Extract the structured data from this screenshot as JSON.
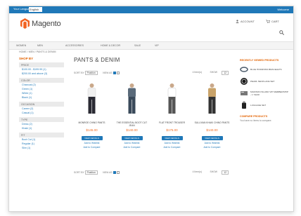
{
  "topbar": {
    "language_label": "Your Language:",
    "language_value": "English",
    "right_link": "Welcome"
  },
  "header": {
    "logo_text": "Magento",
    "account_label": "ACCOUNT",
    "cart_label": "CART"
  },
  "nav": {
    "items": [
      "WOMEN",
      "MEN",
      "ACCESSORIES",
      "HOME & DECOR",
      "SALE",
      "VIP"
    ]
  },
  "breadcrumb": "HOME / MEN / PANTS & DENIM",
  "sidebar": {
    "shop_by": "SHOP BY",
    "filters": [
      {
        "title": "PRICE",
        "options": [
          "$100.00 - $199.99 (1)",
          "$200.00 and above (3)"
        ]
      },
      {
        "title": "COLOR",
        "options": [
          "Charcoal (2)",
          "Green (1)",
          "White (1)",
          "Black (1)"
        ]
      },
      {
        "title": "OCCASION",
        "options": [
          "Career (2)",
          "Casual (1)"
        ]
      },
      {
        "title": "TYPE",
        "options": [
          "Dress (2)",
          "Khaki (1)"
        ]
      },
      {
        "title": "FIT",
        "options": [
          "Boot Cut (1)",
          "Regular (1)",
          "Slim (1)"
        ]
      }
    ]
  },
  "main": {
    "page_title": "PANTS & DENIM",
    "sort_label": "SORT BY",
    "sort_value": "Position",
    "view_label": "VIEW AS",
    "items_text": "4 Item(s)",
    "show_label": "SHOW",
    "show_value": "12"
  },
  "products": [
    {
      "name": "MONROE CHINO PANTS",
      "price": "$145.00",
      "button": "VIEW DETAILS",
      "wishlist": "Add to Wishlist",
      "compare": "Add to Compare",
      "color": "#2a2a33"
    },
    {
      "name": "THE ESSENTIAL BOOT CUT JEAN",
      "price": "$140.00",
      "button": "VIEW DETAILS",
      "wishlist": "Add to Wishlist",
      "compare": "Add to Compare",
      "color": "#3a4a5a"
    },
    {
      "name": "FLAT FRONT TROUSER",
      "price": "$175.00",
      "button": "VIEW DETAILS",
      "wishlist": "Add to Wishlist",
      "compare": "Add to Compare",
      "color": "#555555"
    },
    {
      "name": "SULLIVAN KHAKI CHINO PANTS",
      "price": "$140.00",
      "button": "VIEW DETAILS",
      "wishlist": "Add to Wishlist",
      "compare": "Add to Compare",
      "color": "#333333"
    }
  ],
  "right_sidebar": {
    "recent_title": "RECENTLY VIEWED PRODUCTS",
    "recent_items": [
      "BLUE HORIZONS BRACELETS",
      "PEARL NECKLACE SET",
      "MADISON ISLAND VIP MEMBERSHIP - 1 YEAR",
      "LUGGAGE SET"
    ],
    "compare_title": "COMPARE PRODUCTS",
    "compare_text": "You have no items to compare."
  },
  "colors": {
    "brand_blue": "#1f78b8",
    "price_orange": "#f26c20",
    "accent_orange": "#e36200"
  }
}
